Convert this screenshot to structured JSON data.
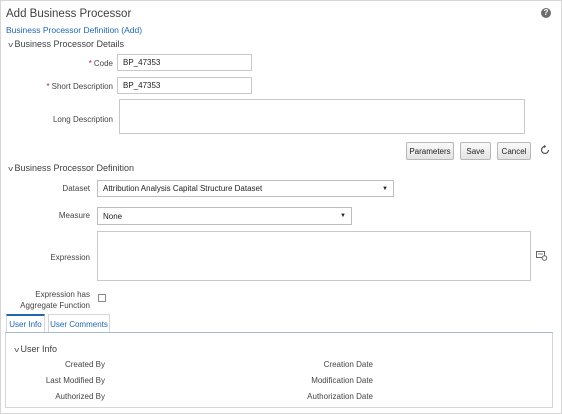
{
  "header": {
    "title": "Add Business Processor",
    "breadcrumb": "Business Processor Definition (Add)",
    "help_icon": "help-icon",
    "help_glyph": "?"
  },
  "details_section": {
    "title": "Business Processor Details",
    "code": {
      "label": "Code",
      "value": "BP_47353",
      "required": true
    },
    "short_description": {
      "label": "Short Description",
      "value": "BP_47353",
      "required": true
    },
    "long_description": {
      "label": "Long Description",
      "value": ""
    }
  },
  "actions": {
    "parameters_label": "Parameters",
    "save_label": "Save",
    "cancel_label": "Cancel",
    "refresh_icon": "refresh-icon"
  },
  "definition_section": {
    "title": "Business Processor Definition",
    "dataset": {
      "label": "Dataset",
      "selected": "Attribution Analysis Capital Structure Dataset"
    },
    "measure": {
      "label": "Measure",
      "selected": "None"
    },
    "expression": {
      "label": "Expression",
      "value": "",
      "icon": "expression-builder-icon"
    },
    "aggregate": {
      "label_line1": "Expression has",
      "label_line2": "Aggregate Function",
      "checked": false
    }
  },
  "tabs": [
    {
      "label": "User Info",
      "active": true
    },
    {
      "label": "User Comments",
      "active": false
    }
  ],
  "user_info": {
    "title": "User Info",
    "created_by_label": "Created By",
    "creation_date_label": "Creation Date",
    "last_modified_by_label": "Last Modified By",
    "modification_date_label": "Modification Date",
    "authorized_by_label": "Authorized By",
    "authorization_date_label": "Authorization Date"
  },
  "colors": {
    "accent": "#1f66b3",
    "required": "#c8102e",
    "border": "#d6d6d6"
  },
  "icons": {
    "section_collapse": "chevron-down-icon"
  }
}
